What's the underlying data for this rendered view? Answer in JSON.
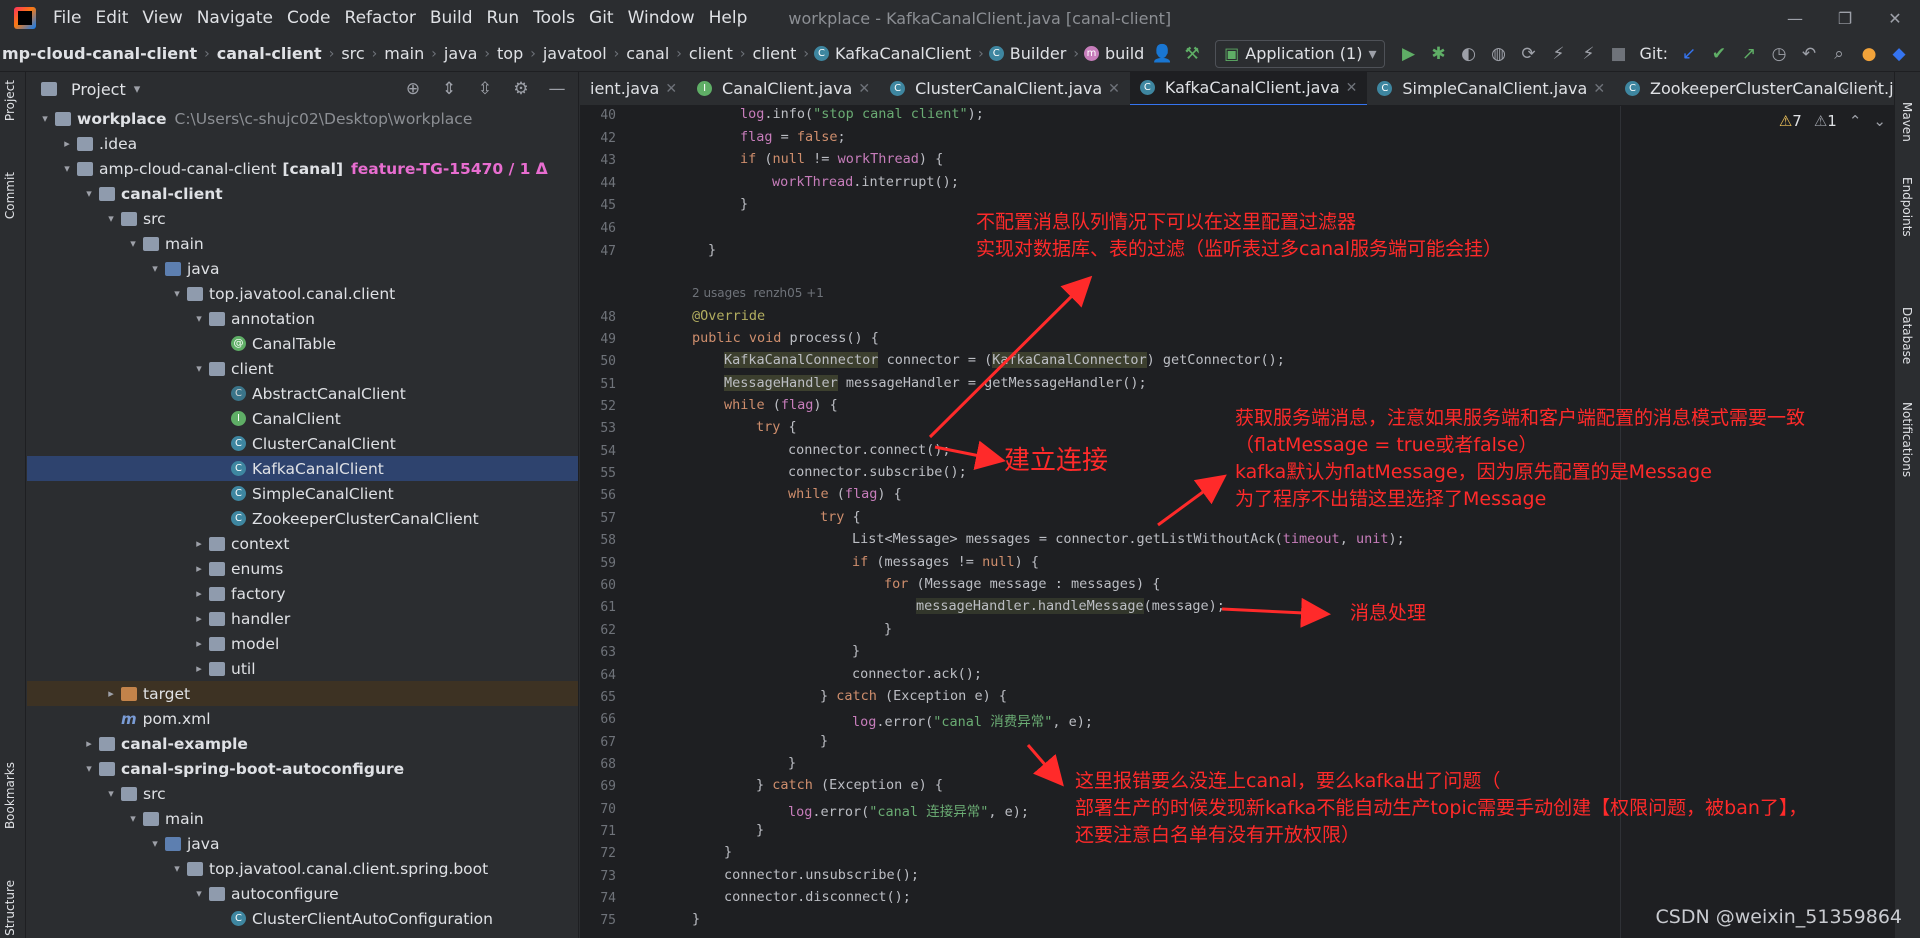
{
  "menubar": {
    "items": [
      "File",
      "Edit",
      "View",
      "Navigate",
      "Code",
      "Refactor",
      "Build",
      "Run",
      "Tools",
      "Git",
      "Window",
      "Help"
    ],
    "title": "workplace - KafkaCanalClient.java [canal-client]"
  },
  "breadcrumb": [
    "mp-cloud-canal-client",
    "canal-client",
    "src",
    "main",
    "java",
    "top",
    "javatool",
    "canal",
    "client",
    "client",
    "KafkaCanalClient",
    "Builder",
    "build"
  ],
  "toolbar": {
    "run_config": "Application (1)",
    "git_label": "Git:"
  },
  "project_panel": {
    "title": "Project"
  },
  "tree": [
    {
      "depth": 0,
      "arrow": "▾",
      "icon": "folder",
      "label": "workplace",
      "extra": "C:\\Users\\c-shujc02\\Desktop\\workplace",
      "bold": true
    },
    {
      "depth": 1,
      "arrow": "▸",
      "icon": "folder",
      "label": ".idea"
    },
    {
      "depth": 1,
      "arrow": "▾",
      "icon": "folder",
      "label": "amp-cloud-canal-client",
      "extra2": "[canal]",
      "branch": "feature-TG-15470 / 1 Δ"
    },
    {
      "depth": 2,
      "arrow": "▾",
      "icon": "folder",
      "label": "canal-client",
      "bold": true
    },
    {
      "depth": 3,
      "arrow": "▾",
      "icon": "folder",
      "label": "src"
    },
    {
      "depth": 4,
      "arrow": "▾",
      "icon": "folder",
      "label": "main"
    },
    {
      "depth": 5,
      "arrow": "▾",
      "icon": "src",
      "label": "java"
    },
    {
      "depth": 6,
      "arrow": "▾",
      "icon": "pkg",
      "label": "top.javatool.canal.client"
    },
    {
      "depth": 7,
      "arrow": "▾",
      "icon": "pkg",
      "label": "annotation"
    },
    {
      "depth": 8,
      "arrow": "",
      "icon": "at",
      "label": "CanalTable"
    },
    {
      "depth": 7,
      "arrow": "▾",
      "icon": "pkg",
      "label": "client"
    },
    {
      "depth": 8,
      "arrow": "",
      "icon": "a",
      "label": "AbstractCanalClient"
    },
    {
      "depth": 8,
      "arrow": "",
      "icon": "i",
      "label": "CanalClient"
    },
    {
      "depth": 8,
      "arrow": "",
      "icon": "c",
      "label": "ClusterCanalClient"
    },
    {
      "depth": 8,
      "arrow": "",
      "icon": "c",
      "label": "KafkaCanalClient",
      "selected": true
    },
    {
      "depth": 8,
      "arrow": "",
      "icon": "c",
      "label": "SimpleCanalClient"
    },
    {
      "depth": 8,
      "arrow": "",
      "icon": "c",
      "label": "ZookeeperClusterCanalClient"
    },
    {
      "depth": 7,
      "arrow": "▸",
      "icon": "pkg",
      "label": "context"
    },
    {
      "depth": 7,
      "arrow": "▸",
      "icon": "pkg",
      "label": "enums"
    },
    {
      "depth": 7,
      "arrow": "▸",
      "icon": "pkg",
      "label": "factory"
    },
    {
      "depth": 7,
      "arrow": "▸",
      "icon": "pkg",
      "label": "handler"
    },
    {
      "depth": 7,
      "arrow": "▸",
      "icon": "pkg",
      "label": "model"
    },
    {
      "depth": 7,
      "arrow": "▸",
      "icon": "pkg",
      "label": "util"
    },
    {
      "depth": 3,
      "arrow": "▸",
      "icon": "tgt",
      "label": "target",
      "target": true
    },
    {
      "depth": 3,
      "arrow": "",
      "icon": "m",
      "label": "pom.xml"
    },
    {
      "depth": 2,
      "arrow": "▸",
      "icon": "folder",
      "label": "canal-example",
      "bold": true
    },
    {
      "depth": 2,
      "arrow": "▾",
      "icon": "folder",
      "label": "canal-spring-boot-autoconfigure",
      "bold": true
    },
    {
      "depth": 3,
      "arrow": "▾",
      "icon": "folder",
      "label": "src"
    },
    {
      "depth": 4,
      "arrow": "▾",
      "icon": "folder",
      "label": "main"
    },
    {
      "depth": 5,
      "arrow": "▾",
      "icon": "src",
      "label": "java"
    },
    {
      "depth": 6,
      "arrow": "▾",
      "icon": "pkg",
      "label": "top.javatool.canal.client.spring.boot"
    },
    {
      "depth": 7,
      "arrow": "▾",
      "icon": "pkg",
      "label": "autoconfigure"
    },
    {
      "depth": 8,
      "arrow": "",
      "icon": "c",
      "label": "ClusterClientAutoConfiguration"
    }
  ],
  "tabs": [
    {
      "label": "ient.java",
      "icon": ""
    },
    {
      "label": "CanalClient.java",
      "icon": "I"
    },
    {
      "label": "ClusterCanalClient.java",
      "icon": "C"
    },
    {
      "label": "KafkaCanalClient.java",
      "icon": "C",
      "active": true
    },
    {
      "label": "SimpleCanalClient.java",
      "icon": "C"
    },
    {
      "label": "ZookeeperClusterCanalClient.java",
      "icon": "C"
    }
  ],
  "inspections": {
    "warnings": "7",
    "weak": "1"
  },
  "gutter_lines": [
    "40",
    "42",
    "43",
    "44",
    "45",
    "46",
    "47",
    "48",
    "49",
    "50",
    "51",
    "52",
    "53",
    "54",
    "55",
    "56",
    "57",
    "58",
    "59",
    "60",
    "61",
    "62",
    "63",
    "64",
    "65",
    "66",
    "67",
    "68",
    "69",
    "70",
    "71",
    "72",
    "73",
    "74",
    "75"
  ],
  "code_hint": "2 usages  renzh05 +1",
  "annotations": {
    "filter": [
      "不配置消息队列情况下可以在这里配置过滤器",
      "实现对数据库、表的过滤（监听表过多canal服务端可能会挂）"
    ],
    "connect": "建立连接",
    "fetch": [
      "获取服务端消息，注意如果服务端和客户端配置的消息模式需要一致",
      "（flatMessage = true或者false）",
      "kafka默认为flatMessage，因为原先配置的是Message",
      "为了程序不出错这里选择了Message"
    ],
    "handle": "消息处理",
    "error": [
      "这里报错要么没连上canal，要么kafka出了问题（",
      "部署生产的时候发现新kafka不能自动生产topic需要手动创建【权限问题，被ban了】，",
      "还要注意白名单有没有开放权限）"
    ]
  },
  "left_strip": [
    "Project",
    "Commit",
    "Bookmarks",
    "Structure"
  ],
  "right_strip": [
    "Maven",
    "Endpoints",
    "Database",
    "Notifications"
  ],
  "watermark": "CSDN @weixin_51359864"
}
